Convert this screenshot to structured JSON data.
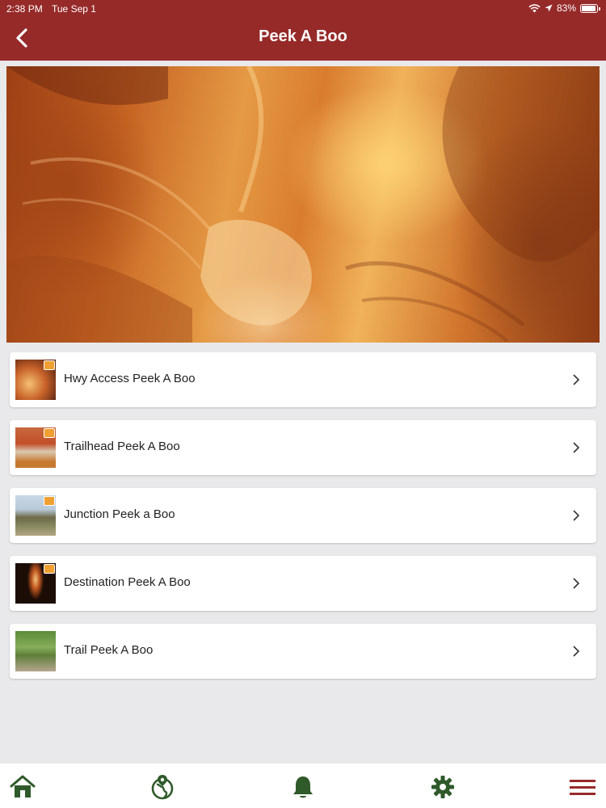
{
  "status": {
    "time": "2:38 PM",
    "date": "Tue Sep 1",
    "battery": "83%",
    "battery_level": 0.83
  },
  "header": {
    "title": "Peek A Boo"
  },
  "items": [
    {
      "label": "Hwy Access Peek A Boo"
    },
    {
      "label": "Trailhead Peek A Boo"
    },
    {
      "label": "Junction Peek a Boo"
    },
    {
      "label": "Destination Peek A Boo"
    },
    {
      "label": "Trail Peek A Boo"
    }
  ],
  "tabbar": {
    "icons": [
      "home-icon",
      "globe-icon",
      "bell-icon",
      "gear-icon",
      "menu-icon"
    ]
  },
  "colors": {
    "brand": "#962a29",
    "tab_icon": "#2f5a2a"
  }
}
